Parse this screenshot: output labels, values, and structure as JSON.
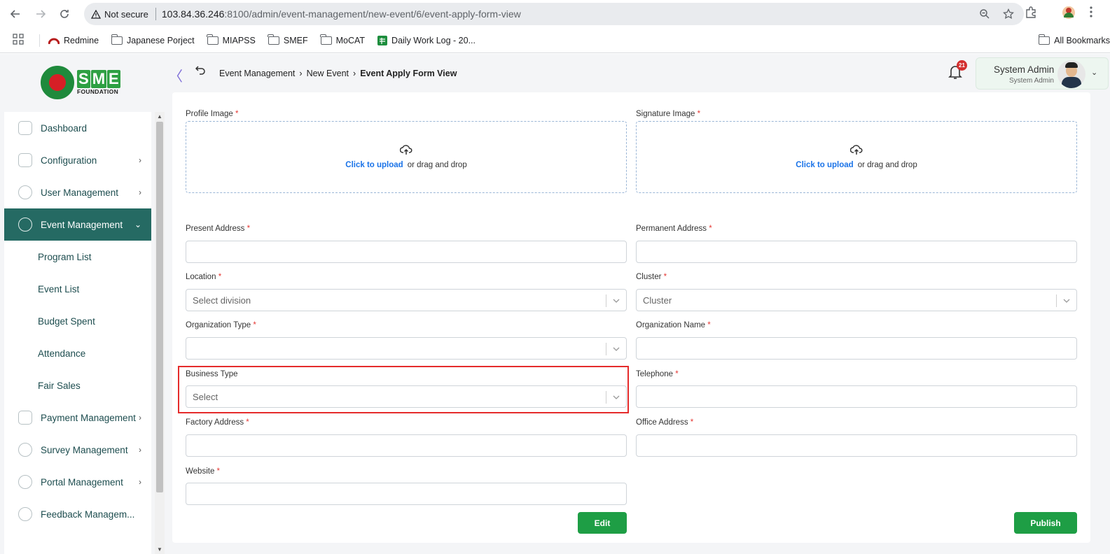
{
  "browser": {
    "security": "Not secure",
    "url_host": "103.84.36.246",
    "url_rest": ":8100/admin/event-management/new-event/6/event-apply-form-view",
    "bookmarks": [
      "Redmine",
      "Japanese Porject",
      "MIAPSS",
      "SMEF",
      "MoCAT",
      "Daily Work Log - 20..."
    ],
    "all_bookmarks": "All Bookmarks"
  },
  "logo": {
    "letters": [
      "S",
      "M",
      "E"
    ],
    "foundation": "FOUNDATION"
  },
  "sidebar": {
    "items": [
      {
        "label": "Dashboard",
        "icon": "grid-icon"
      },
      {
        "label": "Configuration",
        "icon": "puzzle-icon",
        "has_children": true
      },
      {
        "label": "User Management",
        "icon": "shield-user-icon",
        "has_children": true
      },
      {
        "label": "Event Management",
        "icon": "event-icon",
        "has_children": true,
        "expanded": true
      }
    ],
    "sub_items": [
      "Program List",
      "Event List",
      "Budget Spent",
      "Attendance",
      "Fair Sales"
    ],
    "items_after": [
      {
        "label": "Payment Management",
        "icon": "payment-icon"
      },
      {
        "label": "Survey Management",
        "icon": "survey-icon"
      },
      {
        "label": "Portal Management",
        "icon": "portal-icon"
      },
      {
        "label": "Feedback Managem...",
        "icon": "feedback-icon"
      }
    ]
  },
  "topbar": {
    "breadcrumb": [
      "Event Management",
      "New Event",
      "Event Apply Form View"
    ],
    "notification_count": "21",
    "user_name": "System Admin",
    "user_role": "System Admin"
  },
  "form": {
    "profile_image": "Profile Image",
    "signature_image": "Signature Image",
    "upload_link": "Click to upload",
    "upload_rest": "or drag and drop",
    "present_address": "Present Address",
    "permanent_address": "Permanent Address",
    "location": "Location",
    "location_placeholder": "Select division",
    "cluster": "Cluster",
    "cluster_placeholder": "Cluster",
    "organization_type": "Organization Type",
    "organization_name": "Organization Name",
    "business_type": "Business Type",
    "business_type_placeholder": "Select",
    "telephone": "Telephone",
    "factory_address": "Factory Address",
    "office_address": "Office Address",
    "website": "Website",
    "required_mark": "*",
    "edit_label": "Edit",
    "publish_label": "Publish"
  }
}
